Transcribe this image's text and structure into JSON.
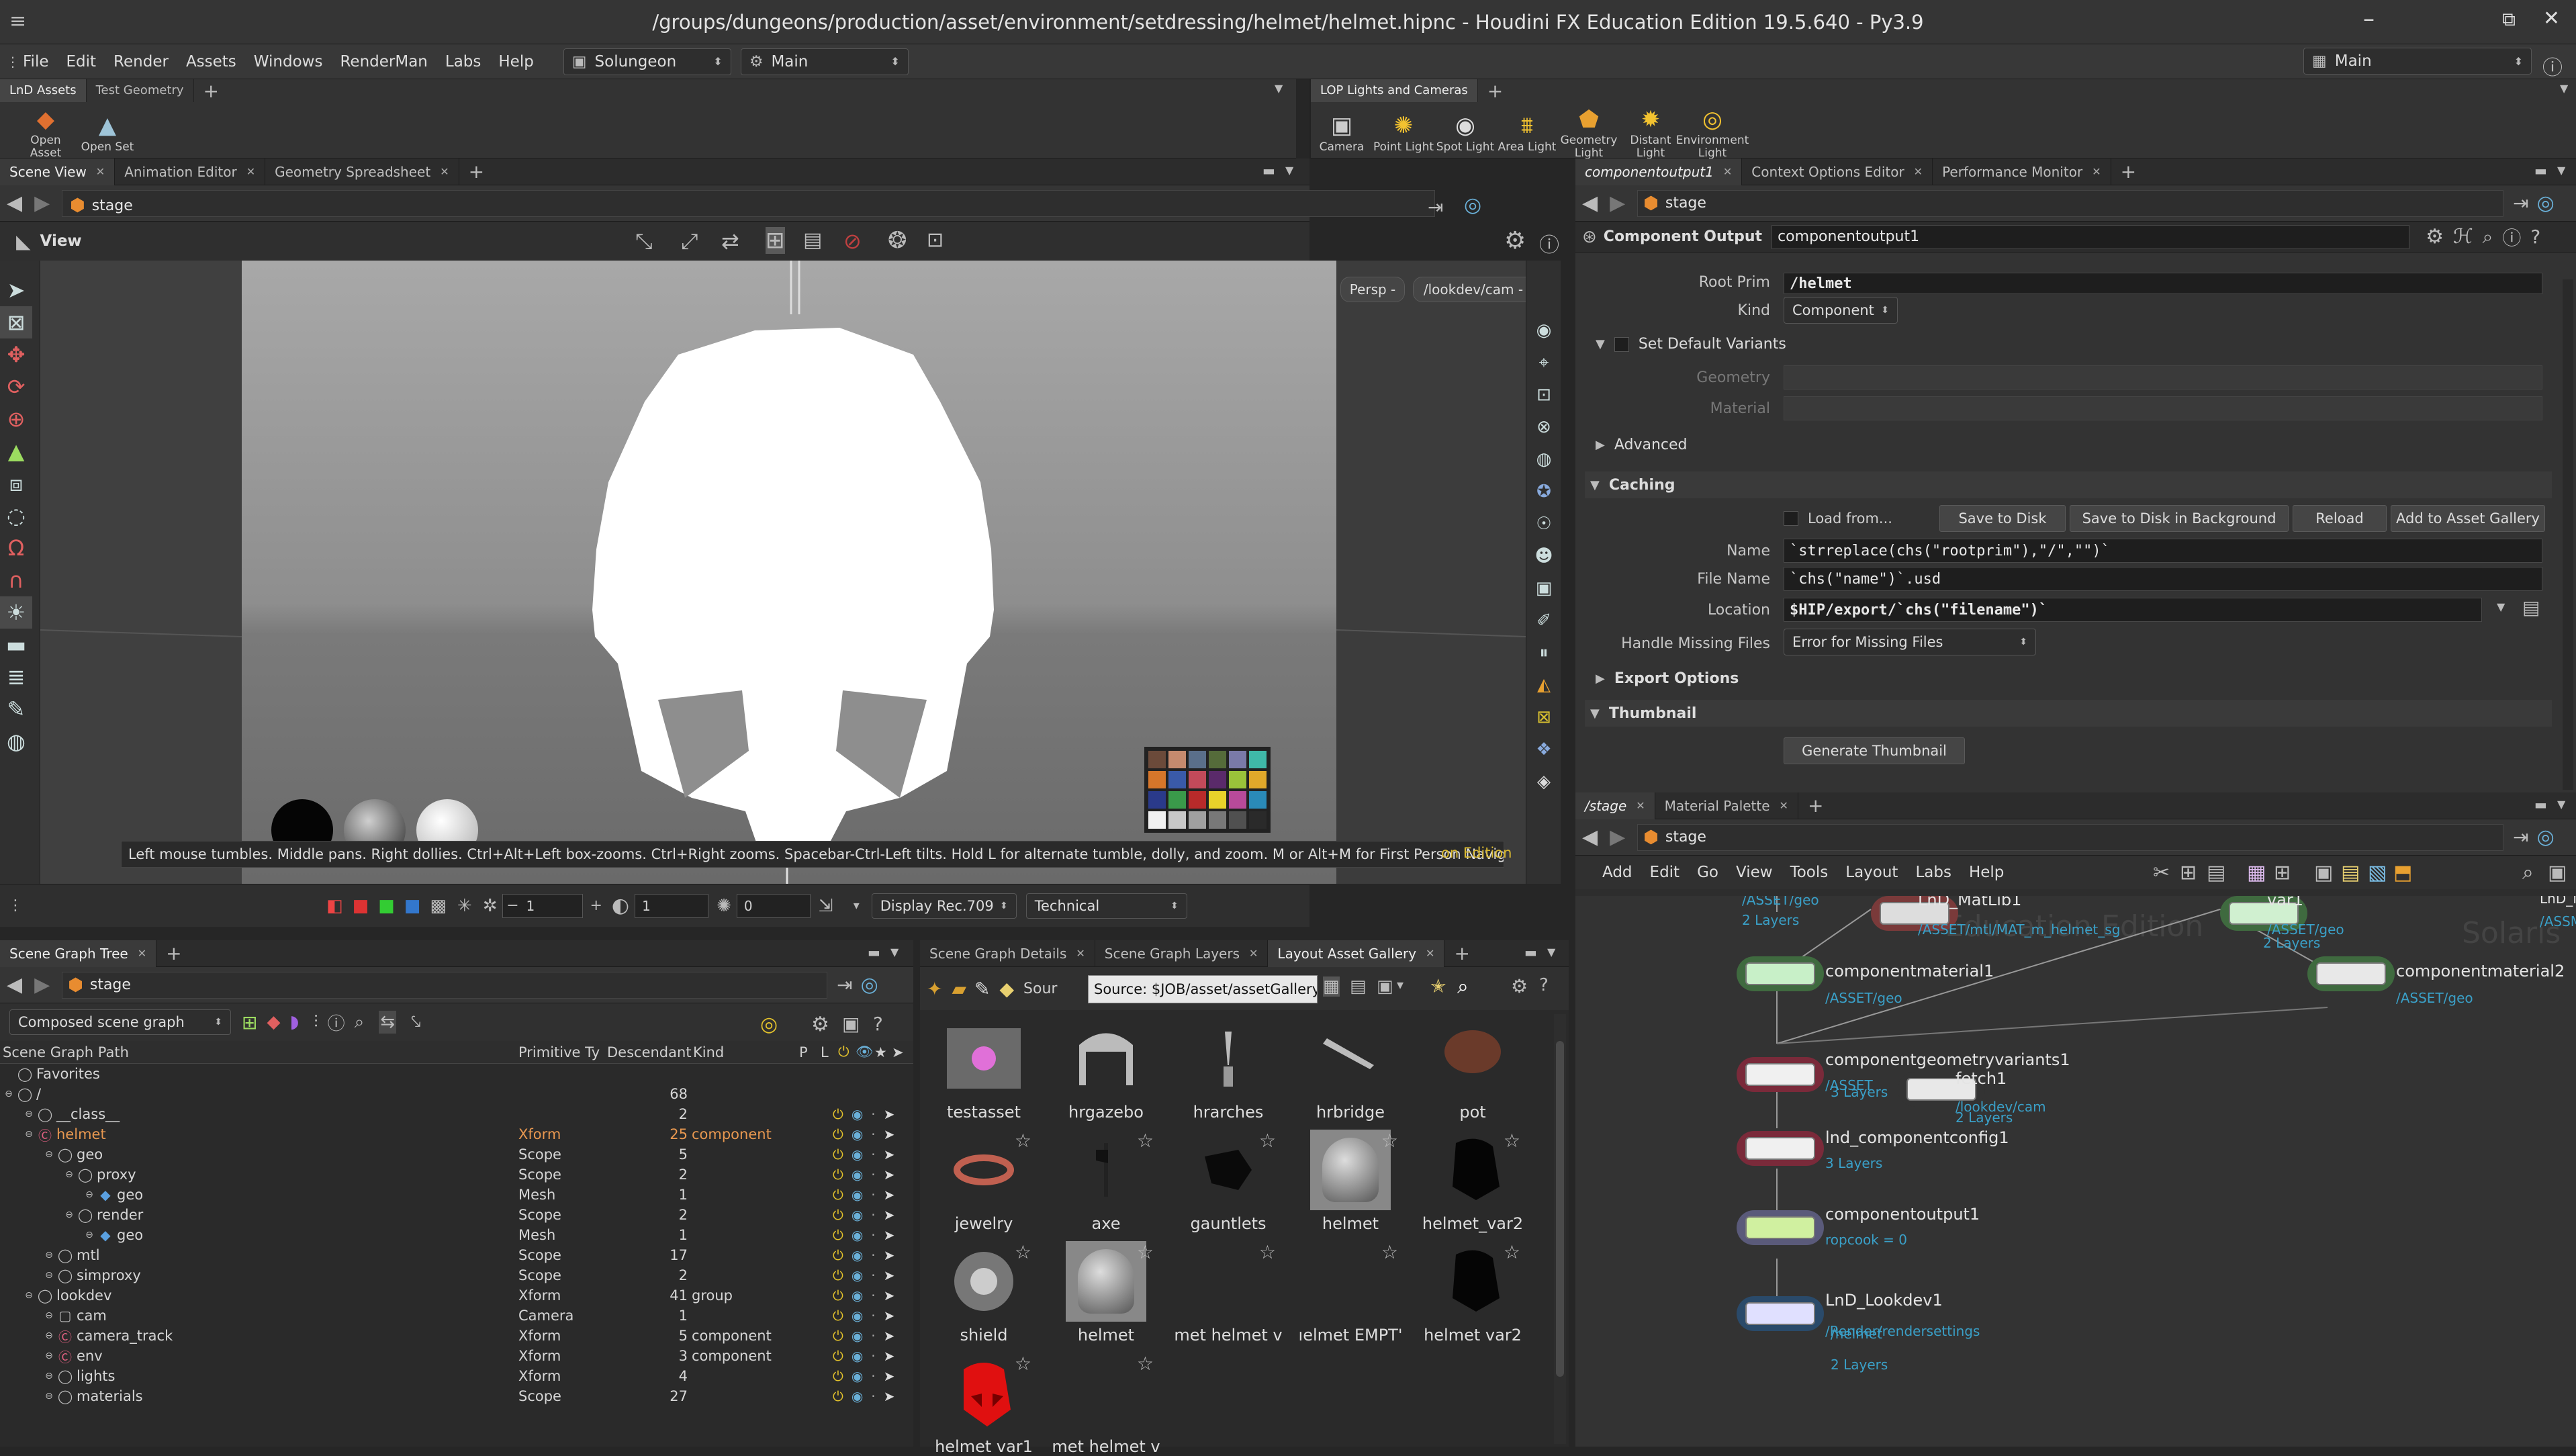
{
  "window": {
    "title": "/groups/dungeons/production/asset/environment/setdressing/helmet/helmet.hipnc - Houdini FX Education Edition 19.5.640 - Py3.9",
    "controls": [
      "–",
      "⧉",
      "✕"
    ]
  },
  "menubar": {
    "items": [
      "File",
      "Edit",
      "Render",
      "Assets",
      "Windows",
      "RenderMan",
      "Labs",
      "Help"
    ],
    "desktop": "Solungeon",
    "context": "Main",
    "right_context": "Main"
  },
  "shelf_left": {
    "tabs": [
      "LnD Assets",
      "Test Geometry"
    ],
    "tools": [
      "Open Asset",
      "Open Set"
    ]
  },
  "shelf_right": {
    "tabs": [
      "LOP Lights and Cameras"
    ],
    "tools": [
      "Camera",
      "Point Light",
      "Spot Light",
      "Area Light",
      "Geometry Light",
      "Distant Light",
      "Environment Light"
    ]
  },
  "viewport_pane": {
    "tabs": [
      "Scene View",
      "Animation Editor",
      "Geometry Spreadsheet"
    ],
    "path": "stage",
    "view_label": "View",
    "camera_buttons": [
      "Persp -",
      "/lookdev/cam -"
    ],
    "status_hint": "Left mouse tumbles. Middle pans. Right dollies. Ctrl+Alt+Left box-zooms. Ctrl+Right zooms. Spacebar-Ctrl-Left tilts. Hold L for alternate tumble, dolly, and zoom.   M or Alt+M for First Person Navigation.",
    "edition_watermark": "on Edition",
    "bottom_bar": {
      "field1": "1",
      "field2": "1",
      "field3": "0",
      "display": "Display Rec.709",
      "view_transform": "Technical"
    },
    "color_chart": [
      "#6b4a3a",
      "#c58a6e",
      "#5a6f8a",
      "#556b3a",
      "#7a7aa8",
      "#3fb8a8",
      "#d6762a",
      "#3a5aa8",
      "#c24a5a",
      "#5a2a6a",
      "#9ac23a",
      "#e0a82a",
      "#2a3a8a",
      "#3a9a4a",
      "#b82a2a",
      "#e8d22a",
      "#b84a9a",
      "#2a8ab8",
      "#f0f0f0",
      "#c8c8c8",
      "#a0a0a0",
      "#787878",
      "#505050",
      "#2a2a2a"
    ]
  },
  "params_pane": {
    "tabs": [
      "componentoutput1",
      "Context Options Editor",
      "Performance Monitor"
    ],
    "path": "stage",
    "node_type": "Component Output",
    "node_name": "componentoutput1",
    "root_prim_label": "Root Prim",
    "root_prim": "/helmet",
    "kind_label": "Kind",
    "kind": "Component",
    "set_default_variants": "Set Default Variants",
    "geometry_label": "Geometry",
    "material_label": "Material",
    "advanced": "Advanced",
    "caching": "Caching",
    "load_from": "Load from...",
    "buttons": [
      "Save to Disk",
      "Save to Disk in Background",
      "Reload",
      "Add to Asset Gallery"
    ],
    "name_label": "Name",
    "name_value": "`strreplace(chs(\"rootprim\"),\"/\",\"\")`",
    "filename_label": "File Name",
    "filename_value": "`chs(\"name\")`.usd",
    "location_label": "Location",
    "location_value": "$HIP/export/`chs(\"filename\")`",
    "missing_label": "Handle Missing Files",
    "missing_value": "Error for Missing Files",
    "export_options": "Export Options",
    "thumbnail": "Thumbnail",
    "generate_thumbnail": "Generate Thumbnail"
  },
  "scene_tree": {
    "tabs": [
      "Scene Graph Tree"
    ],
    "path": "stage",
    "mode": "Composed scene graph",
    "headers": [
      "Scene Graph Path",
      "Primitive Ty",
      "Descendant",
      "Kind",
      "P",
      "L"
    ],
    "rows": [
      {
        "indent": 0,
        "name": "Favorites",
        "type": "",
        "desc": "",
        "kind": ""
      },
      {
        "indent": 0,
        "name": "/",
        "type": "",
        "desc": "68",
        "kind": ""
      },
      {
        "indent": 1,
        "name": "__class__",
        "type": "",
        "desc": "2",
        "kind": ""
      },
      {
        "indent": 1,
        "name": "helmet",
        "type": "Xform",
        "desc": "25",
        "kind": "component"
      },
      {
        "indent": 2,
        "name": "geo",
        "type": "Scope",
        "desc": "5",
        "kind": ""
      },
      {
        "indent": 3,
        "name": "proxy",
        "type": "Scope",
        "desc": "2",
        "kind": ""
      },
      {
        "indent": 4,
        "name": "geo",
        "type": "Mesh",
        "desc": "1",
        "kind": ""
      },
      {
        "indent": 3,
        "name": "render",
        "type": "Scope",
        "desc": "2",
        "kind": ""
      },
      {
        "indent": 4,
        "name": "geo",
        "type": "Mesh",
        "desc": "1",
        "kind": ""
      },
      {
        "indent": 2,
        "name": "mtl",
        "type": "Scope",
        "desc": "17",
        "kind": ""
      },
      {
        "indent": 2,
        "name": "simproxy",
        "type": "Scope",
        "desc": "2",
        "kind": ""
      },
      {
        "indent": 1,
        "name": "lookdev",
        "type": "Xform",
        "desc": "41",
        "kind": "group"
      },
      {
        "indent": 2,
        "name": "cam",
        "type": "Camera",
        "desc": "1",
        "kind": ""
      },
      {
        "indent": 2,
        "name": "camera_track",
        "type": "Xform",
        "desc": "5",
        "kind": "component"
      },
      {
        "indent": 2,
        "name": "env",
        "type": "Xform",
        "desc": "3",
        "kind": "component"
      },
      {
        "indent": 2,
        "name": "lights",
        "type": "Xform",
        "desc": "4",
        "kind": ""
      },
      {
        "indent": 2,
        "name": "materials",
        "type": "Scope",
        "desc": "27",
        "kind": ""
      }
    ]
  },
  "gallery": {
    "tabs": [
      "Scene Graph Details",
      "Scene Graph Layers",
      "Layout Asset Gallery"
    ],
    "source_label": "Sour",
    "tooltip": "Source: $JOB/asset/assetGallery.db",
    "items": [
      {
        "name": "testasset",
        "icon": "pink-sphere"
      },
      {
        "name": "hrgazebo",
        "icon": "gazebo"
      },
      {
        "name": "hrarches",
        "icon": "arch"
      },
      {
        "name": "hrbridge",
        "icon": "bridge"
      },
      {
        "name": "pot",
        "icon": "pot"
      },
      {
        "name": "jewelry",
        "icon": "ring"
      },
      {
        "name": "axe",
        "icon": "axe"
      },
      {
        "name": "gauntlets",
        "icon": "gauntlet"
      },
      {
        "name": "helmet",
        "icon": "helmet-chrome"
      },
      {
        "name": "helmet_var2",
        "icon": "helmet-dark"
      },
      {
        "name": "shield",
        "icon": "shield"
      },
      {
        "name": "helmet",
        "icon": "helmet-chrome"
      },
      {
        "name": "met helmet v",
        "icon": "none"
      },
      {
        "name": "ıelmet  EMPT'",
        "icon": "none"
      },
      {
        "name": "helmet var2",
        "icon": "helmet-dark"
      },
      {
        "name": "helmet var1",
        "icon": "helmet-red"
      },
      {
        "name": "met helmet v",
        "icon": "none"
      }
    ]
  },
  "network": {
    "tabs": [
      "/stage",
      "Material Palette"
    ],
    "path": "stage",
    "menu": [
      "Add",
      "Edit",
      "Go",
      "View",
      "Tools",
      "Layout",
      "Labs",
      "Help"
    ],
    "watermark": "Education Edition",
    "watermark2": "Solaris",
    "nodes": [
      {
        "label": "LnD_MatLib1",
        "sub": "/ASSET/mtl/MAT_m_helmet_sg"
      },
      {
        "label": "var1",
        "sub": "/ASSET/geo"
      },
      {
        "label": "componentmaterial1",
        "sub": "/ASSET/geo"
      },
      {
        "label": "componentmaterial2",
        "sub": "/ASSET/geo"
      },
      {
        "label": "componentgeometryvariants1",
        "sub": "/ASSET"
      },
      {
        "label": "fetch1",
        "sub": "/lookdev/cam"
      },
      {
        "label": "lnd_componentconfig1",
        "sub": "3 Layers"
      },
      {
        "label": "componentoutput1",
        "sub": "ropcook = 0"
      },
      {
        "label": "LnD_Lookdev1",
        "sub": "/Render/rendersettings"
      }
    ],
    "extra": {
      "asset_geo_top": "/ASSET/geo",
      "two_layers_top": "2 Layers",
      "two_layers_var": "2 Layers",
      "three_layers_cgv": "3 Layers",
      "two_layers_fetch": "2 Layers",
      "helmet_path": "/helmet",
      "two_layers_lookdev": "2 Layers",
      "lnd_ma": "LnD_Ma",
      "ssassm": "/ASSM"
    }
  }
}
